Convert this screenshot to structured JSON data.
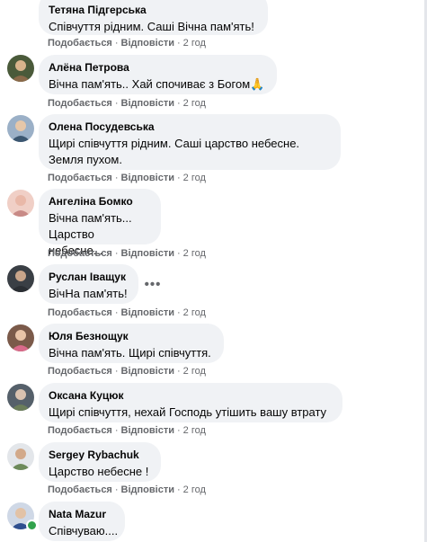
{
  "comments": [
    {
      "author": "Тетяна Підгерська",
      "text": "Співчуття рідним. Саші Вічна пам'ять!",
      "like": "Подобається",
      "reply": "Відповісти",
      "time": "2 год",
      "avatar_colors": [
        "#6f7f8f",
        "#b9c4cc"
      ]
    },
    {
      "author": "Алёна Петрова",
      "text": "Вічна пам'ять.. Хай спочиває з Богом🙏",
      "like": "Подобається",
      "reply": "Відповісти",
      "time": "2 год",
      "avatar_colors": [
        "#4a5a3a",
        "#d8b48c"
      ]
    },
    {
      "author": "Олена Посудевська",
      "text": "Щирі співчуття рідним. Саші царство небесне. Земля пухом.",
      "like": "Подобається",
      "reply": "Відповісти",
      "time": "2 год",
      "avatar_colors": [
        "#3b5670",
        "#9bb0c7"
      ]
    },
    {
      "author": "Ангеліна Бомко",
      "text": "Вічна пам'ять...\nЦарство небесне...",
      "like": "Подобається",
      "reply": "Відповісти",
      "time": "2 год",
      "avatar_colors": [
        "#c88a86",
        "#f0cfc6"
      ]
    },
    {
      "author": "Руслан Іващук",
      "text": "ВічНа пам'ять!",
      "like": "Подобається",
      "reply": "Відповісти",
      "time": "2 год",
      "avatar_colors": [
        "#3a3f45",
        "#c9a58a"
      ]
    },
    {
      "author": "Юля Безнощук",
      "text": "Вічна пам'ять. Щирі співчуття.",
      "like": "Подобається",
      "reply": "Відповісти",
      "time": "2 год",
      "avatar_colors": [
        "#7b5a4a",
        "#e9c4a8"
      ]
    },
    {
      "author": "Оксана Куцюк",
      "text": "Щирі співчуття, нехай Господь утішить вашу втрату",
      "like": "Подобається",
      "reply": "Відповісти",
      "time": "2 год",
      "avatar_colors": [
        "#55606a",
        "#d9c2b0"
      ]
    },
    {
      "author": "Sergey Rybachuk",
      "text": "Царство небесне !",
      "like": "Подобається",
      "reply": "Відповісти",
      "time": "2 год",
      "avatar_colors": [
        "#6d8a5a",
        "#e3e6ea"
      ]
    },
    {
      "author": "Nata Mazur",
      "text": "Співчуваю....",
      "like": "",
      "reply": "",
      "time": "",
      "avatar_colors": [
        "#2f4f8f",
        "#cfd8e6"
      ]
    }
  ],
  "more_options_symbol": "•••",
  "colors": {
    "bubble": "#f0f2f5",
    "meta": "#65676b",
    "online": "#31a24c"
  }
}
